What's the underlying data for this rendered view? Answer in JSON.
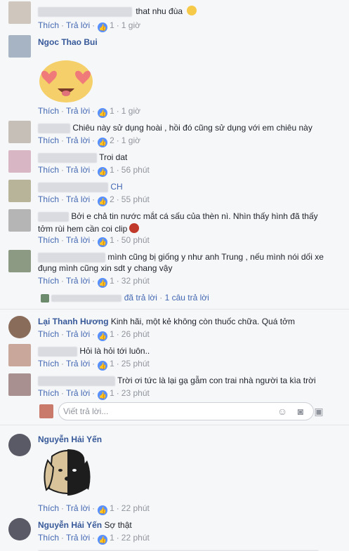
{
  "common": {
    "like": "Thích",
    "reply": "Trả lời",
    "dot": "·",
    "like_icon": "👍"
  },
  "comments": [
    {
      "name": "",
      "text": "that nhu đùa",
      "likes": "1",
      "time": "1 giờ"
    },
    {
      "name": "Ngoc Thao Bui",
      "text": "",
      "likes": "1",
      "time": "1 giờ"
    },
    {
      "name": "",
      "text": "Chiêu này sử dụng hoài , hồi đó cũng sử dụng với em chiêu này",
      "likes": "2",
      "time": "1 giờ"
    },
    {
      "name": "",
      "text": "Troi dat",
      "likes": "1",
      "time": "56 phút"
    },
    {
      "name": "",
      "text": "CH",
      "likes": "2",
      "time": "55 phút"
    },
    {
      "name": "",
      "text_line1": "Bởi e chả tin nước mắt cá sấu của thèn nì. Nhìn thấy hình đã thấy",
      "text_line2": "tởm rùi hem cần coi clip",
      "likes": "1",
      "time": "50 phút"
    },
    {
      "name": "",
      "text_line1": "mình cũng bị giống y như anh Trung , nếu mình nói dối xe",
      "text_line2": "đụng mình cũng xin sdt y chang vậy",
      "likes": "1",
      "time": "32 phút"
    },
    {
      "name": "Lại Thanh Hương",
      "text": "Kinh hãi, một kẻ không còn thuốc chữa. Quá tởm",
      "likes": "1",
      "time": "26 phút"
    },
    {
      "name": "",
      "text": "Hỏi là hỏi tới luôn..",
      "likes": "1",
      "time": "25 phút"
    },
    {
      "name": "",
      "text": "Trời ơi tức là lại gạ gẫm con trai nhà người ta kìa trời",
      "likes": "1",
      "time": "23 phút"
    },
    {
      "name": "Nguyễn Hải Yến",
      "text": "",
      "likes": "1",
      "time": "22 phút"
    },
    {
      "name": "Nguyễn Hải Yến",
      "text": "Sợ thật",
      "likes": "1",
      "time": "22 phút"
    }
  ],
  "reply_summary": {
    "replied_text": "đã trả lời",
    "count_text": "1 câu trả lời"
  },
  "reply_box": {
    "placeholder": "Viết trả lời...",
    "icons": [
      "smiley-icon",
      "camera-icon",
      "sticker-icon"
    ]
  },
  "colors": {
    "name_link": "#365899",
    "action_link": "#4267b2",
    "like_badge": "#5890ff"
  }
}
